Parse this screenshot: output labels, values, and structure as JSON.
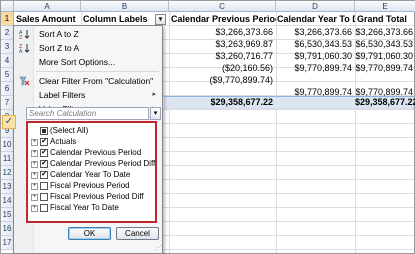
{
  "columns": {
    "a": "A",
    "b": "B",
    "c": "C",
    "d": "D",
    "e": "E"
  },
  "rows": [
    "1",
    "2",
    "3",
    "4",
    "5",
    "6",
    "7",
    "8",
    "9",
    "10",
    "11",
    "12",
    "13",
    "14",
    "15",
    "16",
    "17"
  ],
  "pivot": {
    "header_a": "Sales Amount",
    "header_b": "Column Labels",
    "header_c": "Calendar Previous Period Diff",
    "header_d": "Calendar Year To Date",
    "header_e": "Grand Total",
    "filter_glyph": "▾",
    "data": [
      {
        "c": "$3,266,373.66",
        "d": "$3,266,373.66",
        "e": "$3,266,373.66"
      },
      {
        "c": "$3,263,969.87",
        "d": "$6,530,343.53",
        "e": "$6,530,343.53"
      },
      {
        "c": "$3,260,716.77",
        "d": "$9,791,060.30",
        "e": "$9,791,060.30"
      },
      {
        "c": "($20,160.56)",
        "d": "$9,770,899.74",
        "e": "$9,770,899.74"
      },
      {
        "c": "($9,770,899.74)",
        "d": "",
        "e": ""
      },
      {
        "c": "",
        "d": "$9,770,899.74",
        "e": "$9,770,899.74"
      }
    ],
    "total_c": "$29,358,677.22",
    "total_e": "$29,358,677.22"
  },
  "menu": {
    "sort_az": "Sort A to Z",
    "sort_za": "Sort Z to A",
    "more_sort": "More Sort Options...",
    "clear_filter": "Clear Filter From \"Calculation\"",
    "label_filters": "Label Filters",
    "value_filters": "Value Filters",
    "submenu_arrow": "▸",
    "search_placeholder": "Search Calculation",
    "search_btn_glyph": "▾",
    "side_check": "✓",
    "items": [
      {
        "label": "(Select All)",
        "state": "partial",
        "expander": false
      },
      {
        "label": "Actuals",
        "state": "checked",
        "expander": true
      },
      {
        "label": "Calendar Previous Period",
        "state": "checked",
        "expander": true
      },
      {
        "label": "Calendar Previous Period Diff",
        "state": "checked",
        "expander": true
      },
      {
        "label": "Calendar Year To Date",
        "state": "checked",
        "expander": true
      },
      {
        "label": "Fiscal Previous Period",
        "state": "unchecked",
        "expander": true
      },
      {
        "label": "Fiscal Previous Period Diff",
        "state": "unchecked",
        "expander": true
      },
      {
        "label": "Fiscal Year To Date",
        "state": "unchecked",
        "expander": true
      }
    ],
    "ok": "OK",
    "cancel": "Cancel"
  },
  "icons": {
    "sort_az": "sort-ascending-icon",
    "sort_za": "sort-descending-icon",
    "clear_filter": "clear-filter-icon",
    "check_glyph": "✔",
    "expander_glyph": "+"
  },
  "colors": {
    "listbox_border": "#c0292b",
    "total_row": "#dce6f1",
    "active_row_header": "#f9d99f"
  }
}
